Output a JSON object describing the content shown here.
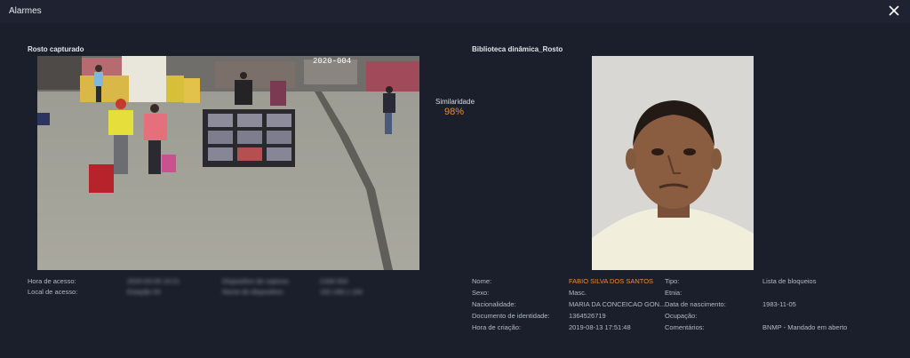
{
  "window": {
    "title": "Alarmes"
  },
  "captured": {
    "label": "Rosto capturado",
    "camera_text": "2020-004"
  },
  "similarity": {
    "label": "Similaridade",
    "value": "98%"
  },
  "library": {
    "label": "Biblioteca dinâmica_Rosto"
  },
  "left_info": {
    "hora_label": "Hora de acesso:",
    "local_label": "Local de acesso:",
    "hora_value": "2020-03-05 10:21",
    "local_value": "Estação 04",
    "extra1_label": "Dispositivo de captura:",
    "extra2_label": "Nome do dispositivo:",
    "extra1_value": "CAM 004",
    "extra2_value": "192.168.1.104"
  },
  "person": {
    "nome_label": "Nome:",
    "nome_value": "FABIO SILVA DOS SANTOS",
    "sexo_label": "Sexo:",
    "sexo_value": "Masc.",
    "nacionalidade_label": "Nacionalidade:",
    "nacionalidade_value": "MARIA DA CONCEICAO GON...",
    "documento_label": "Documento de identidade:",
    "documento_value": "1364526719",
    "criacao_label": "Hora de criação:",
    "criacao_value": "2019-08-13 17:51:48",
    "tipo_label": "Tipo:",
    "tipo_value": "Lista de bloqueios",
    "etnia_label": "Etnia:",
    "nascimento_label": "Data de nascimento:",
    "nascimento_value": "1983-11-05",
    "ocupacao_label": "Ocupação:",
    "comentarios_label": "Comentários:",
    "comentarios_value": "BNMP - Mandado em aberto"
  },
  "colors": {
    "background": "#1b1f2b",
    "accent": "#f08a2c",
    "text": "#b3b9c6"
  },
  "icons": {
    "close": "close-icon"
  }
}
